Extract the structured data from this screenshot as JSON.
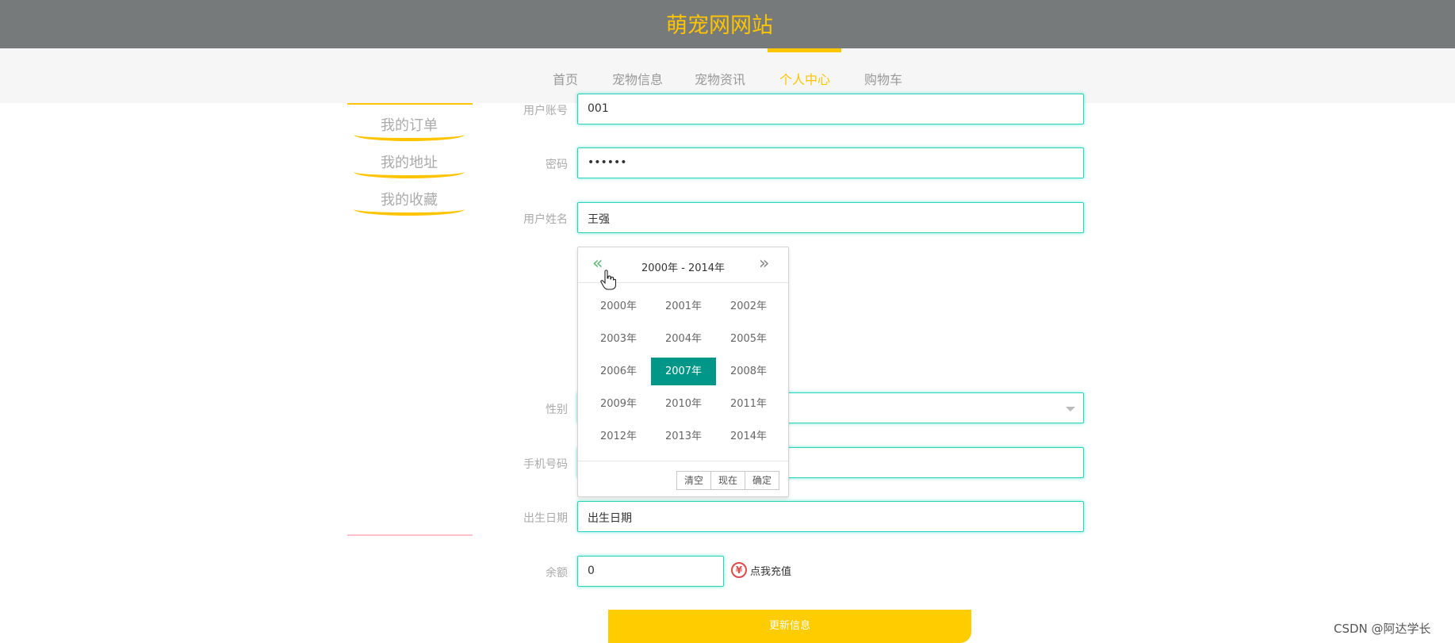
{
  "site": {
    "title": "萌宠网网站"
  },
  "nav": {
    "items": [
      {
        "label": "首页"
      },
      {
        "label": "宠物信息"
      },
      {
        "label": "宠物资讯"
      },
      {
        "label": "个人中心"
      },
      {
        "label": "购物车"
      }
    ],
    "active": "个人中心"
  },
  "sidebar": {
    "items": [
      {
        "label": "我的订单"
      },
      {
        "label": "我的地址"
      },
      {
        "label": "我的收藏"
      }
    ]
  },
  "form": {
    "account": {
      "label": "用户账号",
      "value": "001"
    },
    "password": {
      "label": "密码",
      "value": "••••••"
    },
    "name": {
      "label": "用户姓名",
      "value": "王强"
    },
    "gender": {
      "label": "性别",
      "value": ""
    },
    "phone": {
      "label": "手机号码",
      "value": ""
    },
    "birthday": {
      "label": "出生日期",
      "value": "出生日期"
    },
    "balance": {
      "label": "余额",
      "value": "0"
    },
    "recharge_label": "点我充值",
    "update_button": "更新信息"
  },
  "datepicker": {
    "title": "2000年 - 2014年",
    "prev_icon": "double-chevron-left",
    "next_icon": "double-chevron-right",
    "years": [
      "2000年",
      "2001年",
      "2002年",
      "2003年",
      "2004年",
      "2005年",
      "2006年",
      "2007年",
      "2008年",
      "2009年",
      "2010年",
      "2011年",
      "2012年",
      "2013年",
      "2014年"
    ],
    "selected": "2007年",
    "buttons": {
      "clear": "清空",
      "now": "现在",
      "confirm": "确定"
    }
  },
  "colors": {
    "accent": "#ffc400",
    "field_border": "#2bd5bd",
    "selected_year": "#009688",
    "topbar": "#767a7b"
  },
  "watermark": "CSDN @阿达学长"
}
